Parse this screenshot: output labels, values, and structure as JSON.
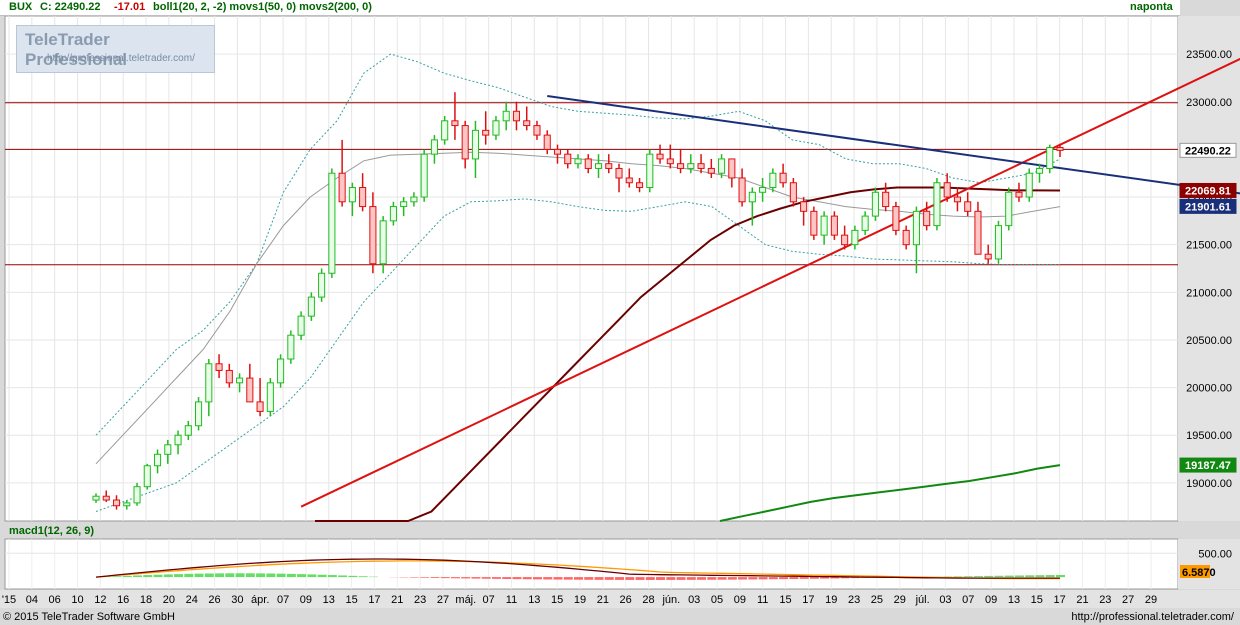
{
  "header": {
    "symbol": "BUX",
    "close_label": "C: 22490.22",
    "change": "-17.01",
    "indicators": "boll1(20, 2, -2) movs1(50, 0) movs2(200, 0)",
    "period": "naponta"
  },
  "logo": {
    "title": "TeleTrader Professional",
    "url": "http://professional.teletrader.com/"
  },
  "macd_header": "macd1(12, 26, 9)",
  "footer": {
    "copyright": "© 2015 TeleTrader Software GmbH",
    "url": "http://professional.teletrader.com/"
  },
  "colors": {
    "up": "#22bb22",
    "down": "#dd1111",
    "bollinger": "#3aa0a0",
    "sma50": "#6b0000",
    "sma200": "#118811",
    "trend_up": "#dd1111",
    "trend_down": "#1a2f7a",
    "hline": "#990000",
    "macd": "#660000",
    "signal": "#ff9900",
    "hist_pos": "#66dd66",
    "hist_neg": "#ff6666"
  },
  "chart_data": {
    "type": "candlestick",
    "y_axis": {
      "ylim": [
        18600,
        23900
      ],
      "ticks": [
        19000,
        19500,
        20000,
        20500,
        21000,
        21500,
        22000,
        22500,
        23000,
        23500
      ],
      "tick_labels": [
        "19000.00",
        "19500.00",
        "20000.00",
        "20500.00",
        "21000.00",
        "21500.00",
        "22000.00",
        "22500.00",
        "23000.00",
        "23500.00"
      ]
    },
    "price_labels": [
      {
        "text": "22490.22",
        "value": 22490,
        "color": "#ffffff",
        "text_color": "#000000"
      },
      {
        "text": "22069.81",
        "value": 22069,
        "color": "#8b0000",
        "text_color": "#ffffff"
      },
      {
        "text": "21901.61",
        "value": 21902,
        "color": "#1a2f7a",
        "text_color": "#ffffff"
      },
      {
        "text": "19187.47",
        "value": 19187,
        "color": "#118811",
        "text_color": "#ffffff"
      }
    ],
    "x_axis_labels": [
      "'15",
      "04",
      "06",
      "10",
      "12",
      "16",
      "18",
      "20",
      "24",
      "26",
      "30",
      "ápr.",
      "07",
      "09",
      "13",
      "15",
      "17",
      "21",
      "23",
      "27",
      "máj.",
      "07",
      "11",
      "13",
      "15",
      "19",
      "21",
      "26",
      "28",
      "jún.",
      "03",
      "05",
      "09",
      "11",
      "15",
      "17",
      "19",
      "23",
      "25",
      "29",
      "júl.",
      "03",
      "07",
      "09",
      "13",
      "15",
      "17",
      "21",
      "23",
      "27",
      "29"
    ],
    "horizontal_lines": [
      22990,
      22500,
      21290
    ],
    "trend_lines": [
      {
        "name": "up",
        "points": [
          [
            20,
            18750
          ],
          [
            118,
            23780
          ]
        ]
      },
      {
        "name": "down",
        "points": [
          [
            44,
            23060
          ],
          [
            128,
            21790
          ]
        ]
      }
    ],
    "candles": [
      [
        18820,
        18890,
        18790,
        18860
      ],
      [
        18860,
        18920,
        18800,
        18820
      ],
      [
        18820,
        18870,
        18720,
        18760
      ],
      [
        18760,
        18810,
        18720,
        18790
      ],
      [
        18790,
        19000,
        18760,
        18960
      ],
      [
        18960,
        19200,
        18930,
        19180
      ],
      [
        19180,
        19350,
        19100,
        19300
      ],
      [
        19300,
        19450,
        19200,
        19400
      ],
      [
        19400,
        19550,
        19300,
        19500
      ],
      [
        19500,
        19650,
        19450,
        19600
      ],
      [
        19600,
        19900,
        19550,
        19850
      ],
      [
        19850,
        20300,
        19700,
        20250
      ],
      [
        20250,
        20350,
        20100,
        20180
      ],
      [
        20180,
        20250,
        20000,
        20050
      ],
      [
        20050,
        20150,
        19950,
        20100
      ],
      [
        20100,
        20250,
        19850,
        19850
      ],
      [
        19850,
        20100,
        19700,
        19750
      ],
      [
        19750,
        20100,
        19700,
        20050
      ],
      [
        20050,
        20350,
        20000,
        20300
      ],
      [
        20300,
        20600,
        20250,
        20550
      ],
      [
        20550,
        20800,
        20500,
        20750
      ],
      [
        20750,
        21000,
        20700,
        20950
      ],
      [
        20950,
        21250,
        20900,
        21200
      ],
      [
        21200,
        22300,
        21150,
        22250
      ],
      [
        22250,
        22600,
        21900,
        21950
      ],
      [
        21950,
        22150,
        21800,
        22100
      ],
      [
        22100,
        22250,
        21850,
        21900
      ],
      [
        21900,
        22050,
        21200,
        21300
      ],
      [
        21300,
        21800,
        21200,
        21750
      ],
      [
        21750,
        21950,
        21700,
        21900
      ],
      [
        21900,
        22000,
        21800,
        21950
      ],
      [
        21950,
        22050,
        21900,
        22000
      ],
      [
        22000,
        22500,
        21950,
        22450
      ],
      [
        22450,
        22650,
        22350,
        22600
      ],
      [
        22600,
        22850,
        22550,
        22800
      ],
      [
        22800,
        23100,
        22600,
        22750
      ],
      [
        22750,
        22800,
        22300,
        22400
      ],
      [
        22400,
        22800,
        22200,
        22700
      ],
      [
        22700,
        22900,
        22550,
        22650
      ],
      [
        22650,
        22850,
        22600,
        22800
      ],
      [
        22800,
        23000,
        22700,
        22900
      ],
      [
        22900,
        23000,
        22700,
        22800
      ],
      [
        22800,
        22950,
        22700,
        22750
      ],
      [
        22750,
        22800,
        22600,
        22650
      ],
      [
        22650,
        22700,
        22450,
        22500
      ],
      [
        22500,
        22550,
        22350,
        22450
      ],
      [
        22450,
        22500,
        22300,
        22350
      ],
      [
        22350,
        22450,
        22300,
        22400
      ],
      [
        22400,
        22450,
        22250,
        22300
      ],
      [
        22300,
        22450,
        22200,
        22350
      ],
      [
        22350,
        22450,
        22250,
        22300
      ],
      [
        22300,
        22350,
        22050,
        22200
      ],
      [
        22200,
        22300,
        22100,
        22150
      ],
      [
        22150,
        22200,
        22050,
        22100
      ],
      [
        22100,
        22500,
        22050,
        22450
      ],
      [
        22450,
        22550,
        22350,
        22400
      ],
      [
        22400,
        22550,
        22300,
        22350
      ],
      [
        22350,
        22500,
        22250,
        22300
      ],
      [
        22300,
        22450,
        22250,
        22350
      ],
      [
        22350,
        22450,
        22250,
        22300
      ],
      [
        22300,
        22400,
        22200,
        22250
      ],
      [
        22250,
        22450,
        22200,
        22400
      ],
      [
        22400,
        22400,
        22100,
        22200
      ],
      [
        22200,
        22300,
        21900,
        21950
      ],
      [
        21950,
        22100,
        21700,
        22050
      ],
      [
        22050,
        22200,
        21950,
        22100
      ],
      [
        22100,
        22300,
        22050,
        22250
      ],
      [
        22250,
        22350,
        22100,
        22150
      ],
      [
        22150,
        22200,
        21900,
        21950
      ],
      [
        21950,
        22000,
        21700,
        21850
      ],
      [
        21850,
        21900,
        21550,
        21600
      ],
      [
        21600,
        21850,
        21500,
        21800
      ],
      [
        21800,
        21850,
        21550,
        21600
      ],
      [
        21600,
        21700,
        21450,
        21500
      ],
      [
        21500,
        21700,
        21450,
        21650
      ],
      [
        21650,
        21850,
        21600,
        21800
      ],
      [
        21800,
        22100,
        21750,
        22050
      ],
      [
        22050,
        22150,
        21850,
        21900
      ],
      [
        21900,
        21950,
        21600,
        21650
      ],
      [
        21650,
        21700,
        21450,
        21500
      ],
      [
        21500,
        21900,
        21200,
        21850
      ],
      [
        21850,
        21950,
        21650,
        21700
      ],
      [
        21700,
        22200,
        21650,
        22150
      ],
      [
        22150,
        22250,
        21950,
        22000
      ],
      [
        22000,
        22100,
        21850,
        21950
      ],
      [
        21950,
        22050,
        21800,
        21850
      ],
      [
        21850,
        21950,
        21550,
        21400
      ],
      [
        21400,
        21500,
        21300,
        21350
      ],
      [
        21350,
        21750,
        21300,
        21700
      ],
      [
        21700,
        22100,
        21650,
        22050
      ],
      [
        22050,
        22150,
        21950,
        22000
      ],
      [
        22000,
        22300,
        21950,
        22250
      ],
      [
        22250,
        22350,
        22150,
        22300
      ],
      [
        22300,
        22550,
        22250,
        22520
      ],
      [
        22520,
        22560,
        22420,
        22490
      ]
    ],
    "bollinger_upper": [
      19500,
      19800,
      20100,
      20400,
      20600,
      20900,
      21300,
      22050,
      22500,
      22800,
      23300,
      23500,
      23420,
      23300,
      23220,
      23150,
      23050,
      22950,
      22900,
      22880,
      22860,
      22830,
      22820,
      22850,
      22900,
      22800,
      22600,
      22550,
      22400,
      22350,
      22350,
      22300,
      22200,
      22150,
      22200,
      22250,
      22400
    ],
    "bollinger_lower": [
      18700,
      18800,
      18900,
      19000,
      19200,
      19400,
      19600,
      19800,
      20100,
      20500,
      20900,
      21200,
      21500,
      21800,
      21950,
      21960,
      21980,
      21950,
      21900,
      21860,
      21850,
      21900,
      21950,
      21900,
      21700,
      21500,
      21430,
      21400,
      21380,
      21350,
      21340,
      21330,
      21320,
      21300,
      21290,
      21290,
      21290
    ],
    "bollinger_mid": [
      19200,
      19500,
      19800,
      20100,
      20400,
      20800,
      21300,
      21700,
      22000,
      22200,
      22380,
      22440,
      22450,
      22460,
      22470,
      22460,
      22440,
      22420,
      22400,
      22380,
      22350,
      22330,
      22300,
      22250,
      22200,
      22100,
      22000,
      21950,
      21900,
      21870,
      21850,
      21820,
      21800,
      21790,
      21800,
      21850,
      21900
    ],
    "sma50": [
      17700,
      17850,
      18000,
      18200,
      18450,
      18700,
      18950,
      19200,
      19450,
      19700,
      19950,
      20200,
      20450,
      20700,
      20950,
      21150,
      21350,
      21550,
      21700,
      21800,
      21880,
      21950,
      22000,
      22050,
      22080,
      22100,
      22100,
      22100,
      22090,
      22080,
      22070,
      22070,
      22069
    ],
    "sma200": [
      18600,
      18650,
      18700,
      18750,
      18800,
      18840,
      18870,
      18900,
      18930,
      18960,
      18990,
      19020,
      19060,
      19100,
      19150,
      19187
    ],
    "macd": {
      "ylim": [
        -250,
        800
      ],
      "tick_labels": [
        "500.00"
      ],
      "value_labels": [
        "6.58",
        "70"
      ]
    }
  }
}
